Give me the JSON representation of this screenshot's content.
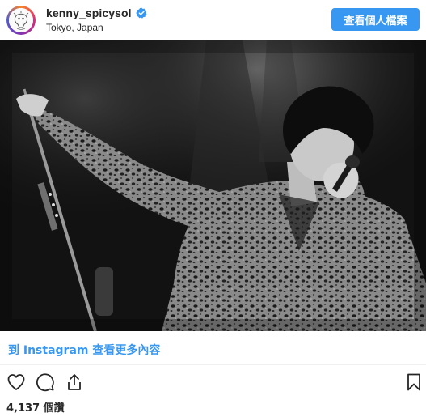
{
  "post": {
    "username": "kenny_spicysol",
    "location": "Tokyo, Japan",
    "profile_button": "查看個人檔案",
    "view_more": "到 Instagram 查看更多內容",
    "likes": "4,137 個讚"
  },
  "icons": {
    "avatar": "avatar-logo",
    "verified": "verified-badge-icon",
    "like": "heart-icon",
    "comment": "comment-icon",
    "share": "share-icon",
    "save": "bookmark-icon"
  },
  "colors": {
    "accent": "#3897f0",
    "text": "#262626"
  }
}
